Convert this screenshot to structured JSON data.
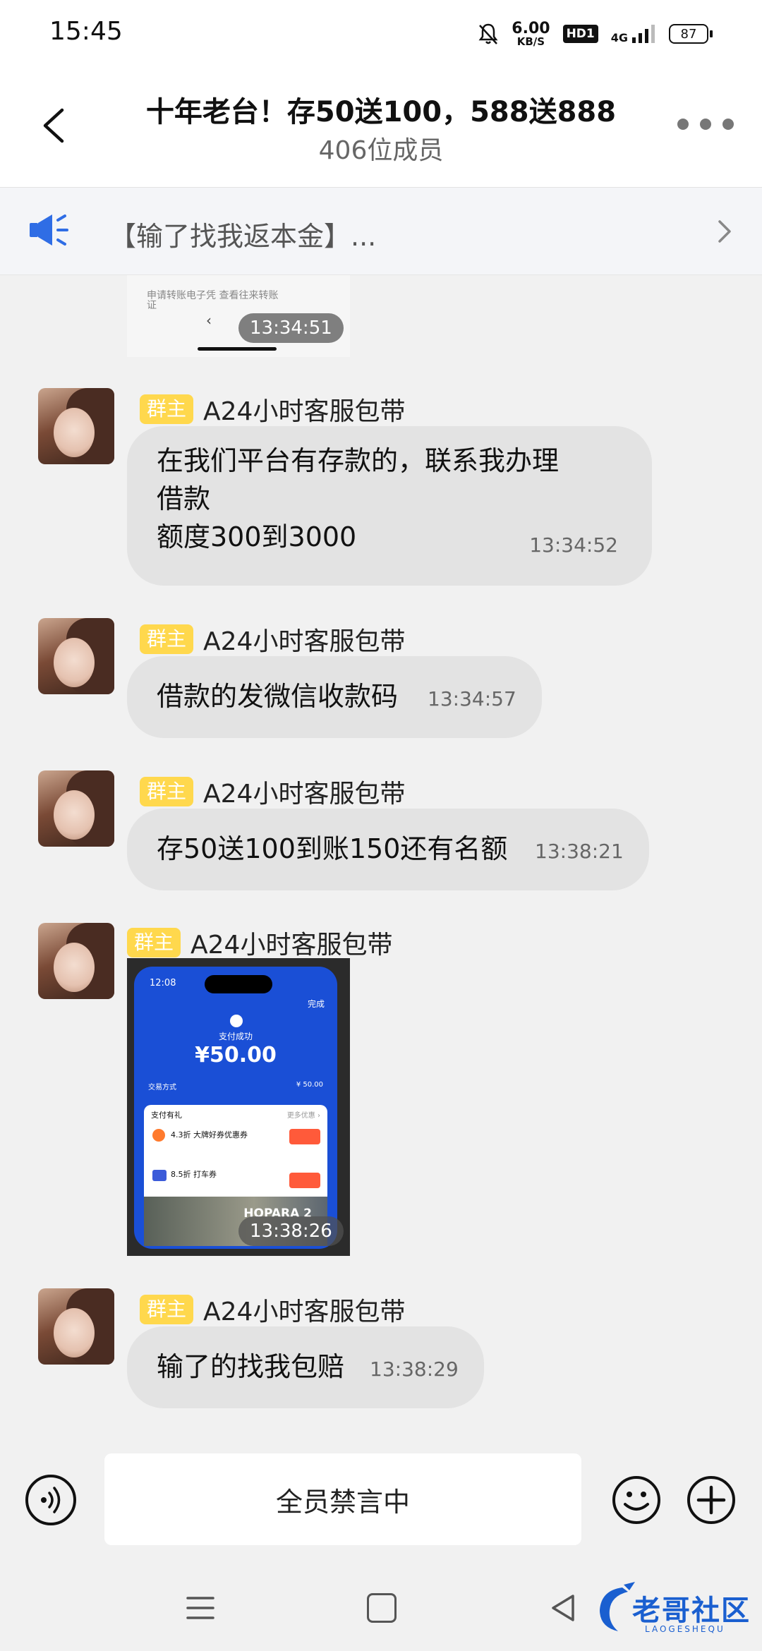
{
  "status_bar": {
    "time": "15:45",
    "speed_value": "6.00",
    "speed_unit": "KB/S",
    "hd": "HD1",
    "network": "4G",
    "battery": "87"
  },
  "header": {
    "title": "十年老台！存50送100，588送888",
    "subtitle": "406位成员"
  },
  "notice": {
    "text": "【输了找我返本金】..."
  },
  "partial_image": {
    "row1": "申请转账电子凭   查看往来转账",
    "row2": "证",
    "time": "13:34:51"
  },
  "messages": [
    {
      "badge": "群主",
      "sender": "A24小时客服包带",
      "lines": [
        "在我们平台有存款的，联系我办理",
        "借款",
        "额度300到3000"
      ],
      "time": "13:34:52"
    },
    {
      "badge": "群主",
      "sender": "A24小时客服包带",
      "lines": [
        "借款的发微信收款码"
      ],
      "time": "13:34:57"
    },
    {
      "badge": "群主",
      "sender": "A24小时客服包带",
      "lines": [
        "存50送100到账150还有名额"
      ],
      "time": "13:38:21"
    },
    {
      "badge": "群主",
      "sender": "A24小时客服包带",
      "image": {
        "phone_time": "12:08",
        "done": "完成",
        "status": "支付成功",
        "amount": "¥50.00",
        "row_left": "交易方式",
        "row_right": "¥ 50.00",
        "card_title": "支付有礼",
        "card_more": "更多优惠 ›",
        "offer1": "4.3折 大牌好券优惠券",
        "offer2": "8.5折 打车券",
        "ad_brand": "HOPARA 2"
      },
      "time": "13:38:26"
    },
    {
      "badge": "群主",
      "sender": "A24小时客服包带",
      "lines": [
        "输了的找我包赔"
      ],
      "time": "13:38:29"
    }
  ],
  "input_bar": {
    "mute_text": "全员禁言中"
  },
  "watermark": {
    "text": "老哥社区",
    "sub": "LAOGESHEQU"
  },
  "colors": {
    "badge": "#ffd84d",
    "bubble": "#e3e3e3",
    "notice_icon": "#2f6de5"
  }
}
